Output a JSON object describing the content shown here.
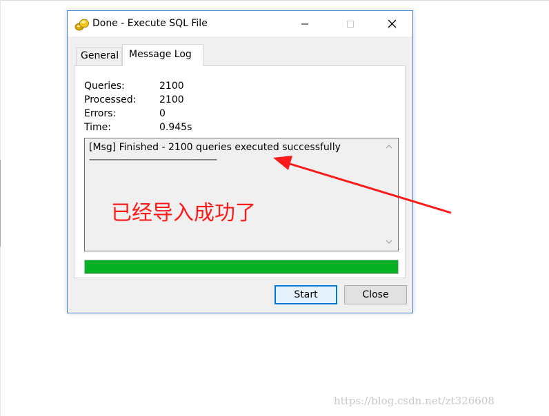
{
  "window": {
    "title": "Done - Execute SQL File",
    "icons": {
      "app": "database-app-icon",
      "minimize": "minimize-icon",
      "maximize": "maximize-icon",
      "close": "close-icon"
    }
  },
  "tabs": [
    {
      "label": "General",
      "active": false
    },
    {
      "label": "Message Log",
      "active": true
    }
  ],
  "stats": [
    {
      "label": "Queries:",
      "value": "2100"
    },
    {
      "label": "Processed:",
      "value": "2100"
    },
    {
      "label": "Errors:",
      "value": "0"
    },
    {
      "label": "Time:",
      "value": "0.945s"
    }
  ],
  "log": {
    "lines": [
      "[Msg] Finished - 2100 queries executed successfully",
      "------------------------------------------------"
    ]
  },
  "progress": {
    "value": 1.0,
    "color": "#06b025"
  },
  "buttons": {
    "start": "Start",
    "close": "Close"
  },
  "annotation": {
    "text": "已经导入成功了",
    "color": "#ff1a1a"
  },
  "watermark": "https://blog.csdn.net/zt326608"
}
